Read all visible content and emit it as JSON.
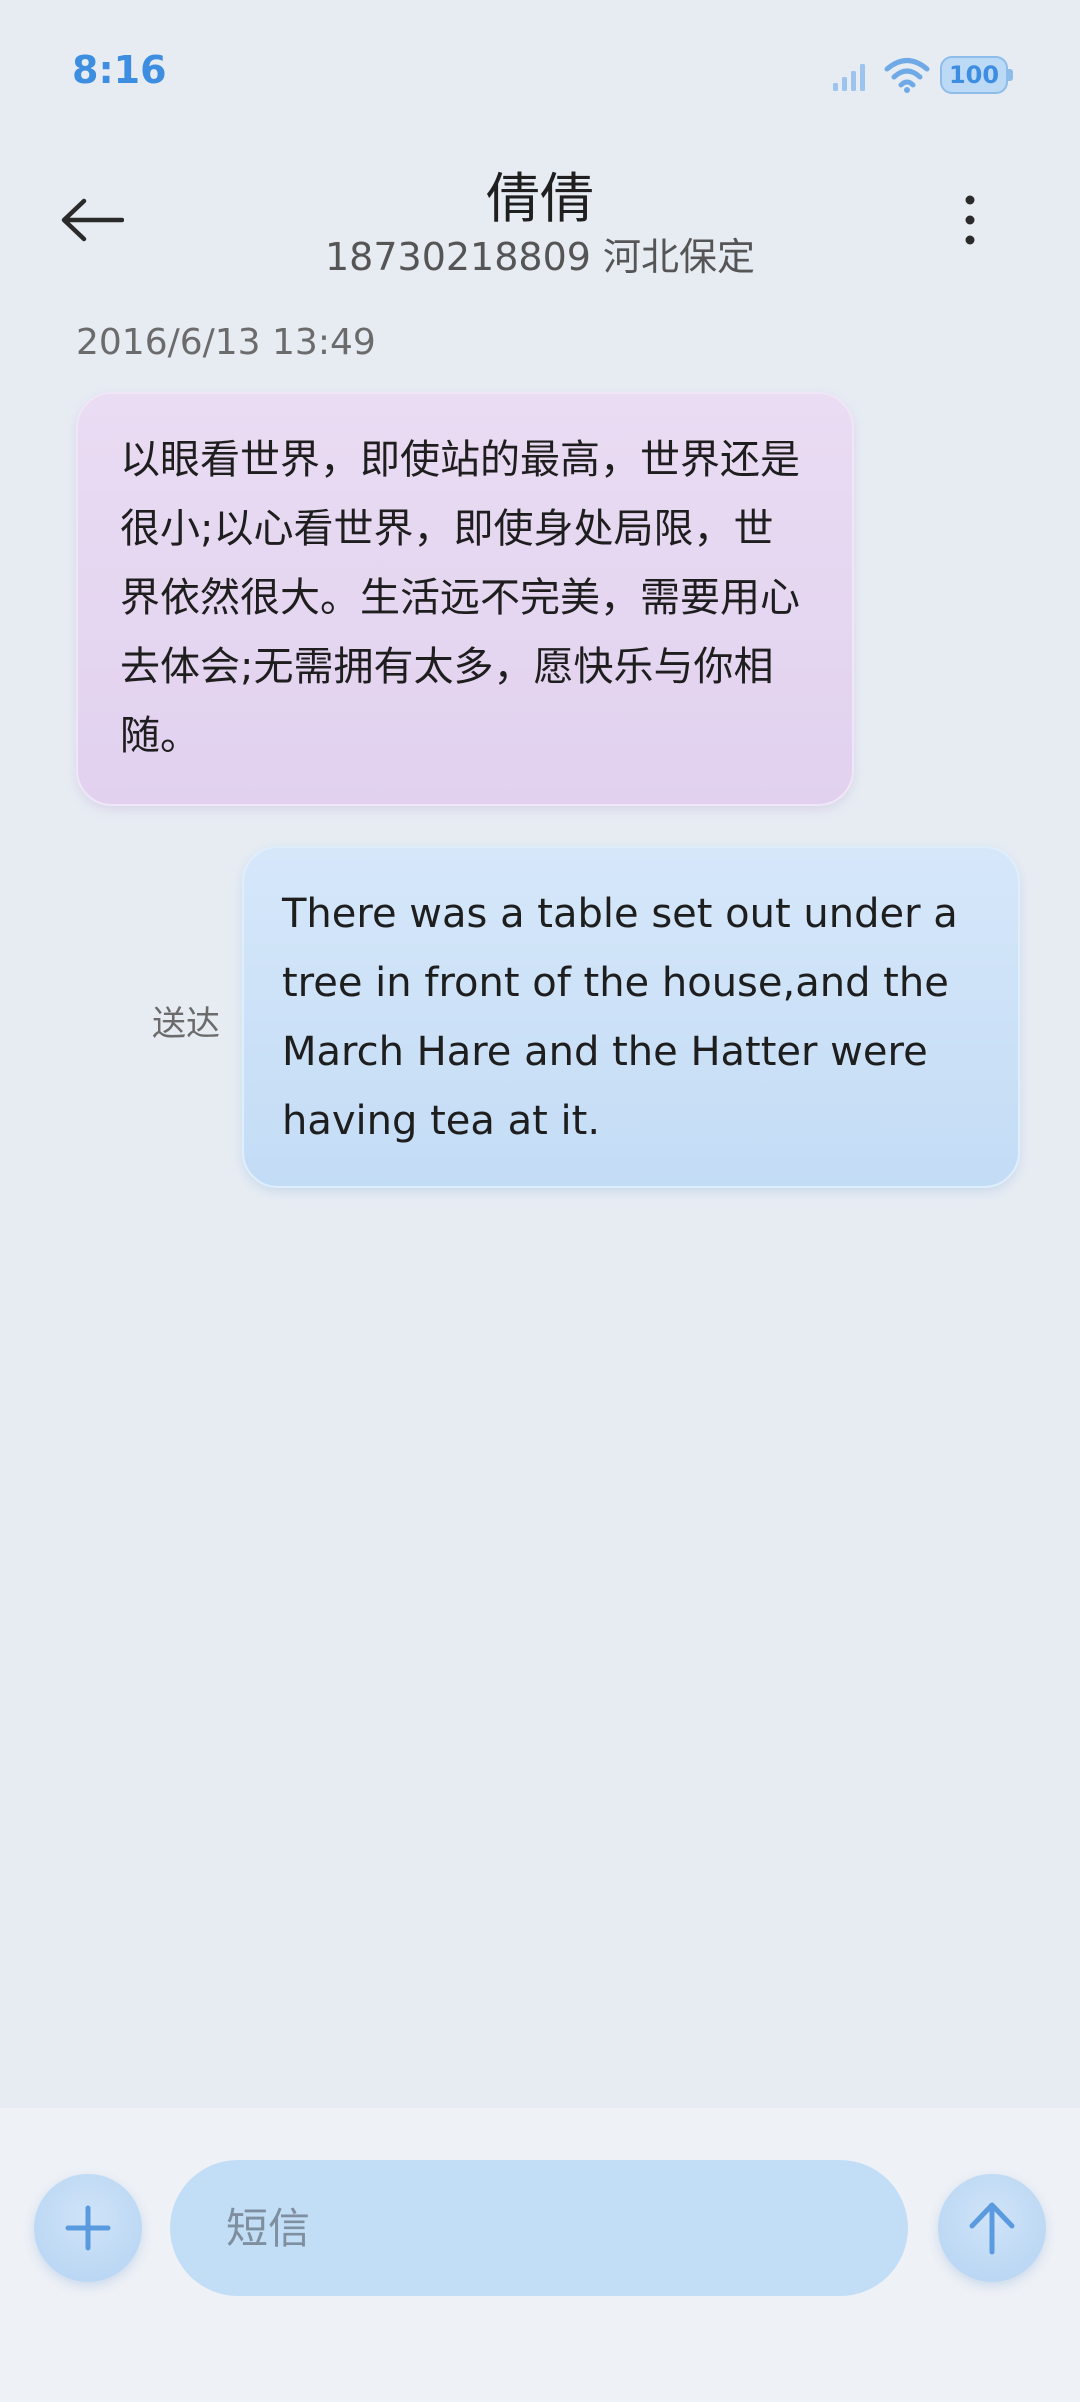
{
  "status_bar": {
    "time": "8:16",
    "battery_level": "100",
    "icons": [
      "signal-icon",
      "wifi-icon",
      "battery-icon"
    ],
    "accent_color": "#3d8de0"
  },
  "header": {
    "contact_name": "倩倩",
    "contact_number_location": "18730218809 河北保定",
    "icons": [
      "back-arrow-icon",
      "more-vertical-icon"
    ]
  },
  "conversation": {
    "timestamp": "2016/6/13 13:49",
    "messages": [
      {
        "direction": "received",
        "text": "以眼看世界，即使站的最高，世界还是很小;以心看世界，即使身处局限，世界依然很大。生活远不完美，需要用心去体会;无需拥有太多，愿快乐与你相随。",
        "color": "#e6d8f2"
      },
      {
        "direction": "sent",
        "text": "There was a table set out under a tree in front of the house,and the March Hare and the Hatter were having tea at it.",
        "status": "送达",
        "color": "#cde2f8"
      }
    ]
  },
  "input_bar": {
    "placeholder": "短信",
    "value": "",
    "icons": [
      "plus-icon",
      "send-arrow-icon"
    ]
  }
}
